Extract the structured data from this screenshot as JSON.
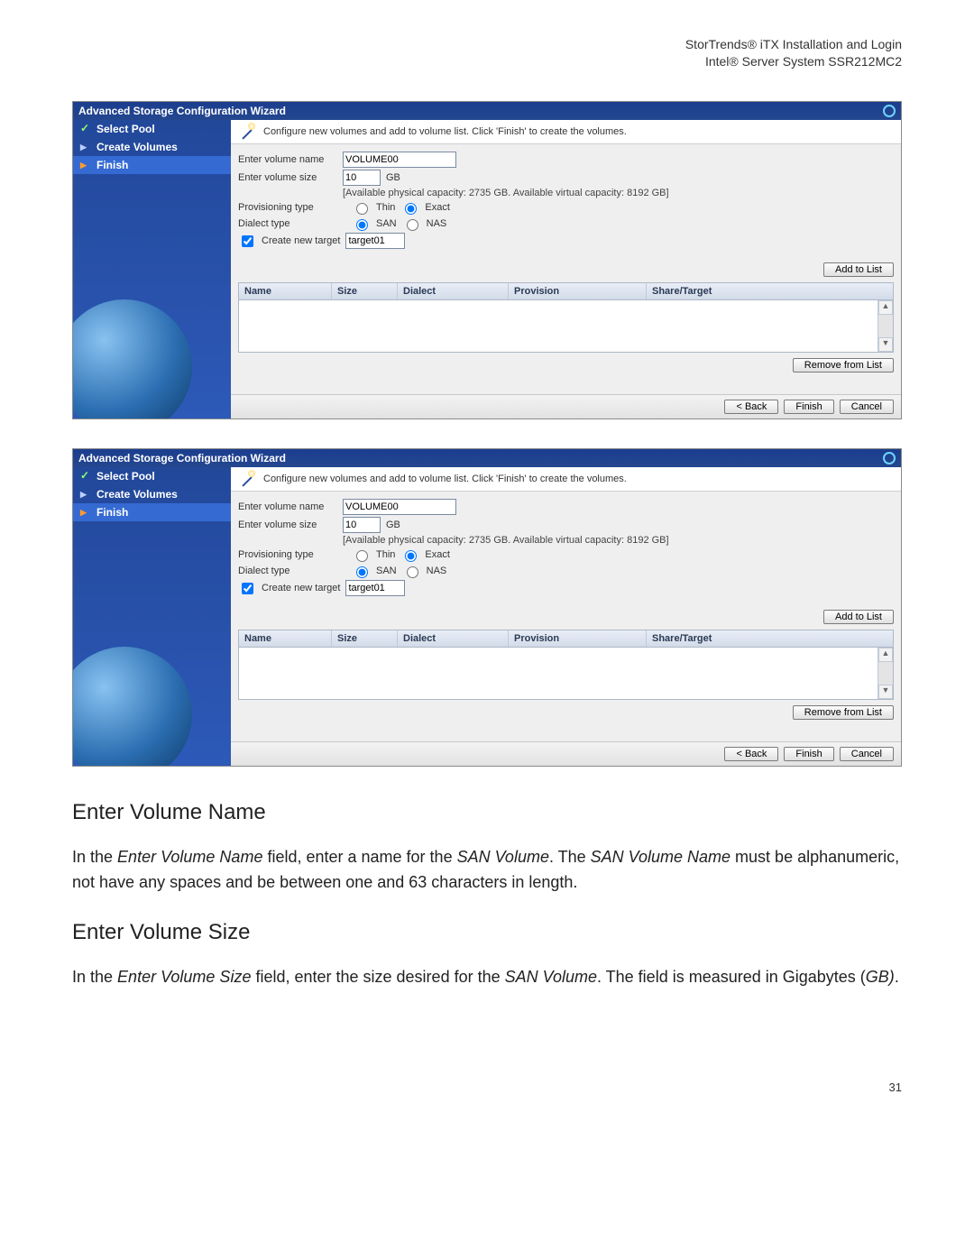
{
  "header": {
    "line1": "StorTrends® iTX Installation and Login",
    "line2": "Intel® Server System SSR212MC2"
  },
  "wizard": {
    "title": "Advanced Storage Configuration Wizard",
    "instruction": "Configure new volumes and add to volume list. Click 'Finish' to create the volumes.",
    "steps": {
      "select_pool": "Select Pool",
      "create_volumes": "Create Volumes",
      "finish": "Finish"
    },
    "form": {
      "volume_name_label": "Enter volume name",
      "volume_name_value": "VOLUME00",
      "volume_size_label": "Enter volume size",
      "volume_size_value": "10",
      "volume_size_unit": "GB",
      "capacity_note": "[Available physical capacity: 2735 GB. Available virtual capacity: 8192 GB]",
      "provisioning_label": "Provisioning type",
      "provisioning_thin": "Thin",
      "provisioning_exact": "Exact",
      "dialect_label": "Dialect type",
      "dialect_san": "SAN",
      "dialect_nas": "NAS",
      "create_target_label": "Create new target",
      "create_target_value": "target01"
    },
    "buttons": {
      "add_to_list": "Add to List",
      "remove_from_list": "Remove from List",
      "back": "< Back",
      "finish": "Finish",
      "cancel": "Cancel"
    },
    "grid": {
      "headers": [
        "Name",
        "Size",
        "Dialect",
        "Provision",
        "Share/Target"
      ],
      "rows": []
    }
  },
  "sections": {
    "h1": "Enter Volume Name",
    "p1a": "In the ",
    "p1b": "Enter Volume Name",
    "p1c": " field, enter a name for the ",
    "p1d": "SAN Volume",
    "p1e": ". The ",
    "p1f": "SAN Volume Name",
    "p1g": " must be alphanumeric, not have any spaces and be between one and 63 characters in length.",
    "h2": "Enter Volume Size",
    "p2a": "In the ",
    "p2b": "Enter Volume Size",
    "p2c": " field, enter the size desired for the ",
    "p2d": "SAN Volume",
    "p2e": ". The field is measured in Gigabytes (",
    "p2f": "GB)",
    "p2g": "."
  },
  "page_number": "31"
}
